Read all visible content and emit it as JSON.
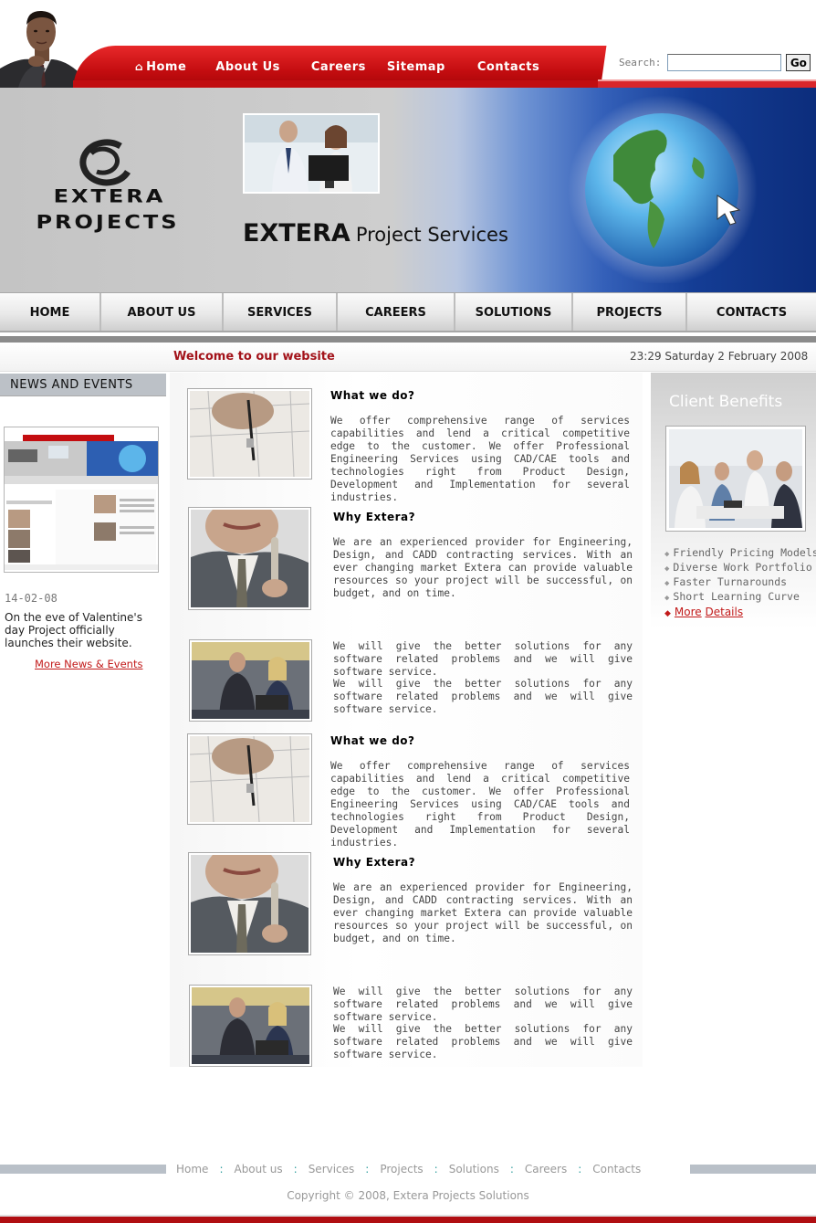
{
  "header": {
    "nav": [
      "Home",
      "About Us",
      "Careers",
      "Sitemap",
      "Contacts"
    ],
    "search_label": "Search:",
    "search_placeholder": "",
    "search_button": "Go"
  },
  "banner": {
    "logo_line1": "EXTERA",
    "logo_line2": "PROJECTS",
    "title_bold": "EXTERA",
    "title_rest": "Project Services"
  },
  "mainnav": [
    "HOME",
    "ABOUT US",
    "SERVICES",
    "CAREERS",
    "SOLUTIONS",
    "PROJECTS",
    "CONTACTS"
  ],
  "welcome": {
    "text": "Welcome to our website",
    "datetime": "23:29  Saturday 2 February 2008"
  },
  "news": {
    "heading": "NEWS AND EVENTS",
    "date": "14-02-08",
    "text": "On the eve of Valentine's day Project officially launches their website.",
    "more": "More News & Events"
  },
  "content": {
    "blocks": [
      {
        "title": "What we do?",
        "text": "We offer comprehensive range of services capabilities and lend a critical competitive edge to the customer. We offer Professional Engineering Services using CAD/CAE tools and technologies right from Product Design, Development and Implementation for several industries."
      },
      {
        "title": "Why Extera?",
        "text": "We are an experienced provider for Engineering, Design, and CADD contracting services. With an ever changing market Extera can provide valuable resources so your project will be successful, on budget, and on time."
      },
      {
        "title": "",
        "text": "We will give the better solutions for any software related problems and we will give software service.",
        "text2": "We will give the better solutions for any software related problems and we will give software service."
      },
      {
        "title": "What we do?",
        "text": "We offer comprehensive range of services capabilities and lend a critical competitive edge to the customer. We offer Professional Engineering Services using CAD/CAE tools and technologies right from Product Design, Development and Implementation for several industries."
      },
      {
        "title": "Why Extera?",
        "text": "We are an experienced provider for Engineering, Design, and CADD contracting services. With an ever changing market Extera can provide valuable resources so your project will be successful, on budget, and on time."
      },
      {
        "title": "",
        "text": "We will give the better solutions for any software related problems and we will give software service.",
        "text2": "We will give the better solutions for any software related problems and we will give software service."
      }
    ]
  },
  "client_benefits": {
    "title": "Client Benefits",
    "items": [
      "Friendly Pricing Models",
      "Diverse Work Portfolio",
      "Faster Turnarounds",
      "Short Learning Curve"
    ],
    "more": "More",
    "details": "Details"
  },
  "footer": {
    "links": [
      "Home",
      "About us",
      "Services",
      "Projects",
      "Solutions",
      "Careers",
      "Contacts"
    ],
    "separator": ":",
    "copyright": "Copyright © 2008, Extera Projects Solutions"
  },
  "colors": {
    "brand_red": "#c40d10",
    "link_red": "#c21a1a",
    "banner_blue": "#143d95"
  }
}
